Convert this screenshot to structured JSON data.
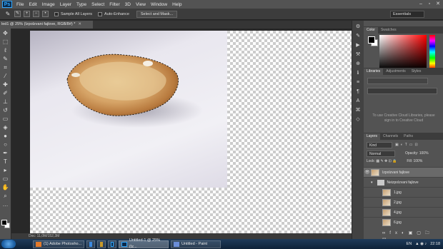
{
  "menubar": {
    "logo": "Ps",
    "items": [
      "File",
      "Edit",
      "Image",
      "Layer",
      "Type",
      "Select",
      "Filter",
      "3D",
      "View",
      "Window",
      "Help"
    ]
  },
  "options": {
    "sample_all_layers": "Sample All Layers",
    "auto_enhance": "Auto-Enhance",
    "select_mask": "Select and Mask...",
    "workspace": "Essentials"
  },
  "document": {
    "tab_title": "led1 @ 25% (Izpolzvani fajlove, RGB/8#) *",
    "status": "Doc: 11,0M/152,3M"
  },
  "panels": {
    "color_tabs": [
      "Color",
      "Swatches"
    ],
    "library_tabs": [
      "Libraries",
      "Adjustments",
      "Styles"
    ],
    "cloud_message": "To use Creative Cloud Libraries, please sign in to Creative Cloud",
    "layers_tabs": [
      "Layers",
      "Channels",
      "Paths"
    ],
    "kind": "Kind",
    "blend_mode": "Normal",
    "opacity_label": "Opacity:",
    "opacity_value": "100%",
    "lock_label": "Lock:",
    "fill_label": "Fill:",
    "fill_value": "100%",
    "layers": [
      {
        "name": "Izpolzvani fajlove",
        "type": "layer",
        "selected": true,
        "visible": true
      },
      {
        "name": "Neizpolzvani fajlove",
        "type": "group",
        "selected": false,
        "visible": false
      },
      {
        "name": "1.jpg",
        "type": "layer",
        "selected": false,
        "visible": false
      },
      {
        "name": "2.jpg",
        "type": "layer",
        "selected": false,
        "visible": false
      },
      {
        "name": "4.jpg",
        "type": "layer",
        "selected": false,
        "visible": false
      },
      {
        "name": "6.jpg",
        "type": "layer",
        "selected": false,
        "visible": false
      }
    ]
  },
  "taskbar": {
    "tasks": [
      "(1) Adobe Photosho...",
      "Untitled-1 @ 25% (Iz...",
      "Untitled - Paint"
    ],
    "language": "EN",
    "time": "22:18"
  },
  "colors": {
    "accent": "#31a8ff",
    "selected_layer": "#6a6a6a"
  }
}
